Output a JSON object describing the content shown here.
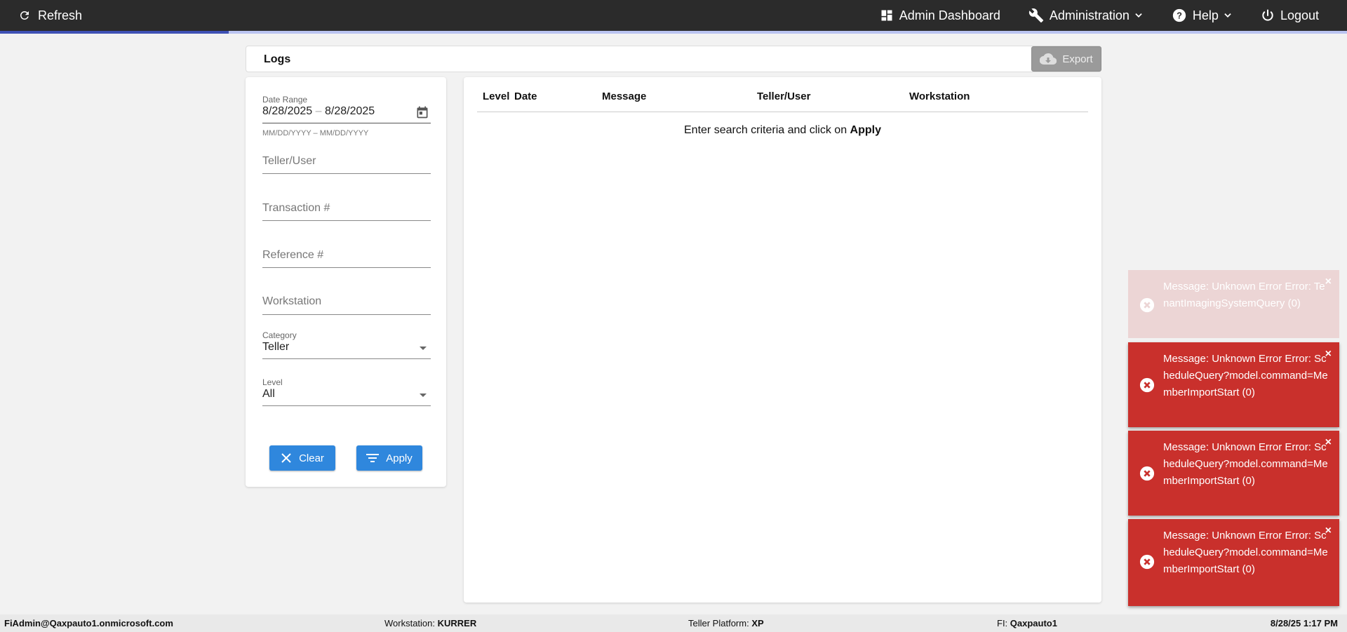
{
  "topbar": {
    "refresh_label": "Refresh",
    "nav": {
      "admin_dashboard": "Admin Dashboard",
      "administration": "Administration",
      "help": "Help",
      "logout": "Logout"
    }
  },
  "progress": {
    "value": 0.17
  },
  "logs": {
    "title": "Logs",
    "export_label": "Export"
  },
  "filters": {
    "date_range": {
      "label": "Date Range",
      "start": "8/28/2025",
      "separator": "–",
      "end": "8/28/2025",
      "hint": "MM/DD/YYYY – MM/DD/YYYY"
    },
    "teller_user": {
      "placeholder": "Teller/User"
    },
    "transaction": {
      "placeholder": "Transaction #"
    },
    "reference": {
      "placeholder": "Reference #"
    },
    "workstation": {
      "placeholder": "Workstation"
    },
    "category": {
      "label": "Category",
      "value": "Teller"
    },
    "level": {
      "label": "Level",
      "value": "All"
    },
    "clear_label": "Clear",
    "apply_label": "Apply"
  },
  "results": {
    "columns": [
      "Level",
      "Date",
      "Message",
      "Teller/User",
      "Workstation"
    ],
    "empty_prefix": "Enter search criteria and click on ",
    "empty_action": "Apply"
  },
  "toasts": [
    {
      "message": "Message: Unknown Error Error: TenantImagingSystemQuery (0)",
      "faded": true
    },
    {
      "message": "Message: Unknown Error Error: ScheduleQuery?model.command=MemberImportStart (0)",
      "faded": false
    },
    {
      "message": "Message: Unknown Error Error: ScheduleQuery?model.command=MemberImportStart (0)",
      "faded": false
    },
    {
      "message": "Message: Unknown Error Error: ScheduleQuery?model.command=MemberImportStart (0)",
      "faded": false
    }
  ],
  "toast_close_glyph": "×",
  "statusbar": {
    "user": "FiAdmin@Qaxpauto1.onmicrosoft.com",
    "workstation_label": "Workstation: ",
    "workstation_value": "KURRER",
    "platform_label": "Teller Platform: ",
    "platform_value": "XP",
    "fi_label": "FI: ",
    "fi_value": "Qaxpauto1",
    "datetime": "8/28/25 1:17 PM"
  },
  "colors": {
    "topbar": "#2b2b2b",
    "accent": "#3f51b5",
    "button": "#2f87dd",
    "error": "#c9302c"
  }
}
